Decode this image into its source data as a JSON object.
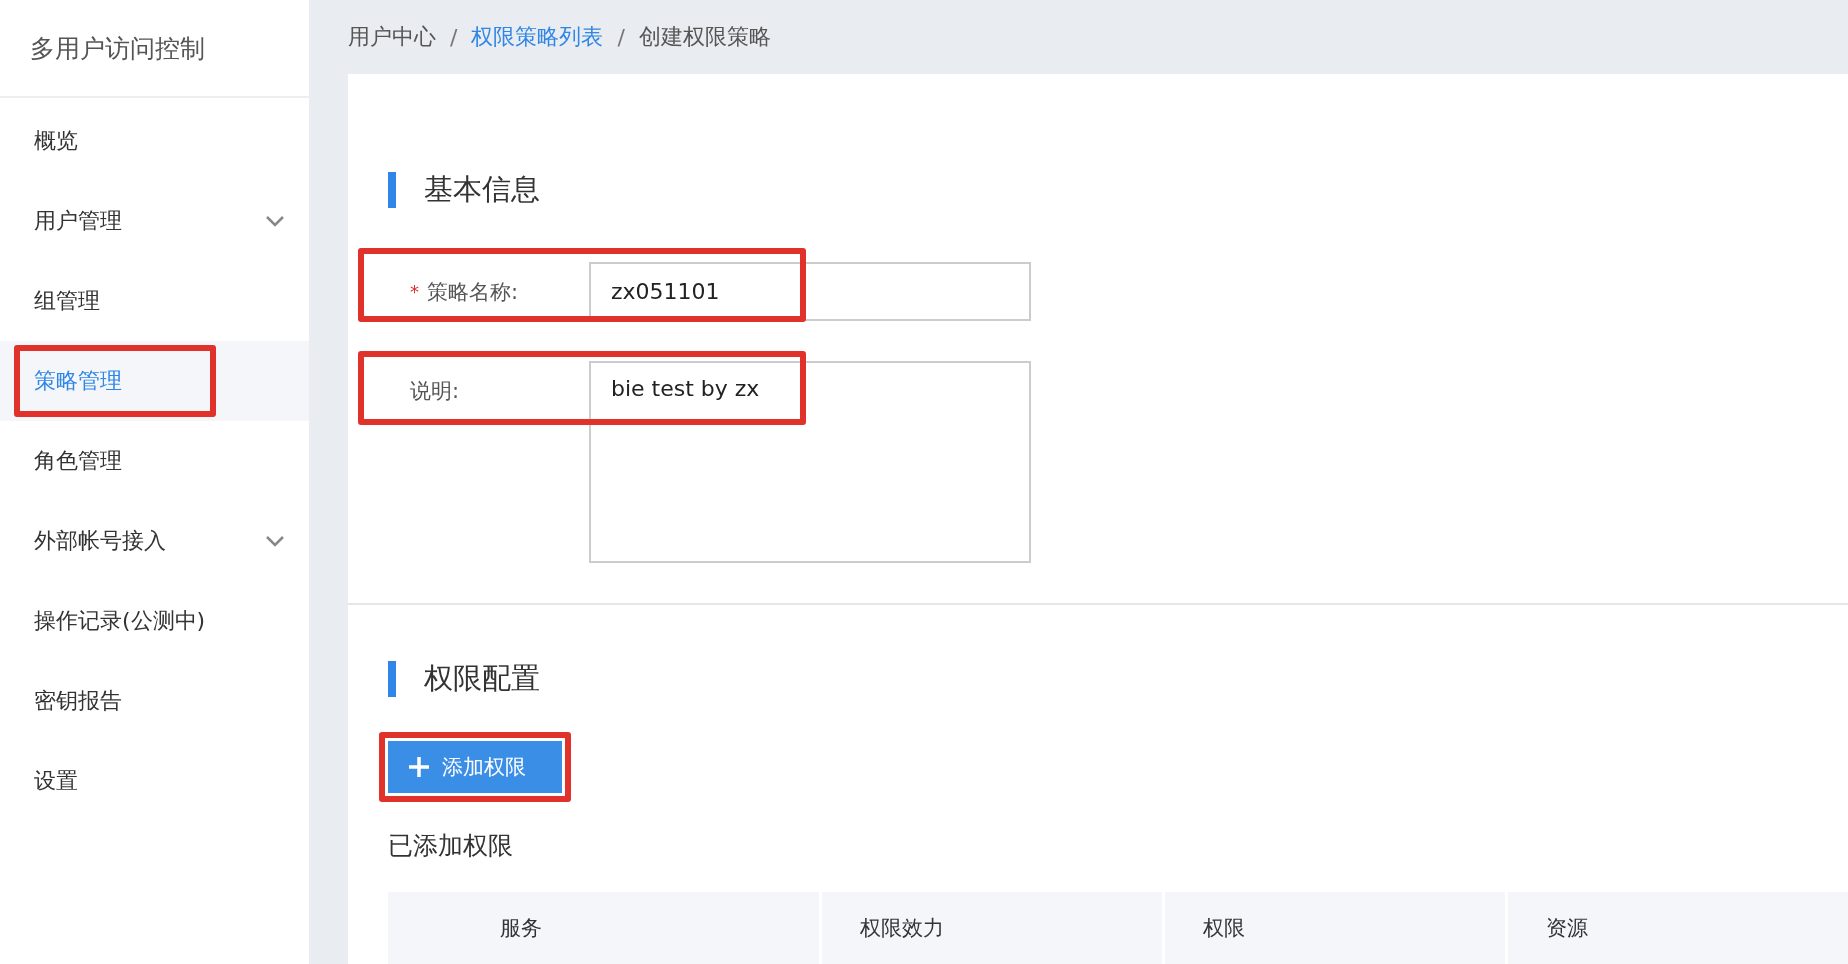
{
  "sidebar": {
    "title": "多用户访问控制",
    "items": [
      {
        "label": "概览",
        "selected": false,
        "expandable": false,
        "highlighted": false
      },
      {
        "label": "用户管理",
        "selected": false,
        "expandable": true,
        "highlighted": false
      },
      {
        "label": "组管理",
        "selected": false,
        "expandable": false,
        "highlighted": false
      },
      {
        "label": "策略管理",
        "selected": true,
        "expandable": false,
        "highlighted": true
      },
      {
        "label": "角色管理",
        "selected": false,
        "expandable": false,
        "highlighted": false
      },
      {
        "label": "外部帐号接入",
        "selected": false,
        "expandable": true,
        "highlighted": false
      },
      {
        "label": "操作记录(公测中)",
        "selected": false,
        "expandable": false,
        "highlighted": false
      },
      {
        "label": "密钥报告",
        "selected": false,
        "expandable": false,
        "highlighted": false
      },
      {
        "label": "设置",
        "selected": false,
        "expandable": false,
        "highlighted": false
      }
    ]
  },
  "breadcrumb": {
    "separator": "/",
    "items": [
      {
        "label": "用户中心",
        "link": false
      },
      {
        "label": "权限策略列表",
        "link": true
      },
      {
        "label": "创建权限策略",
        "link": false
      }
    ]
  },
  "basic_info": {
    "title": "基本信息",
    "fields": [
      {
        "kind": "input",
        "label": "策略名称:",
        "required_mark": "*",
        "value": "zx051101",
        "highlighted": true
      },
      {
        "kind": "textarea",
        "label": "说明:",
        "value": "bie test by zx",
        "highlighted": true
      }
    ]
  },
  "permissions": {
    "title": "权限配置",
    "add_button": {
      "label": "添加权限",
      "highlighted": true
    },
    "subtitle": "已添加权限",
    "table": {
      "columns": [
        "服务",
        "权限效力",
        "权限",
        "资源"
      ]
    }
  }
}
